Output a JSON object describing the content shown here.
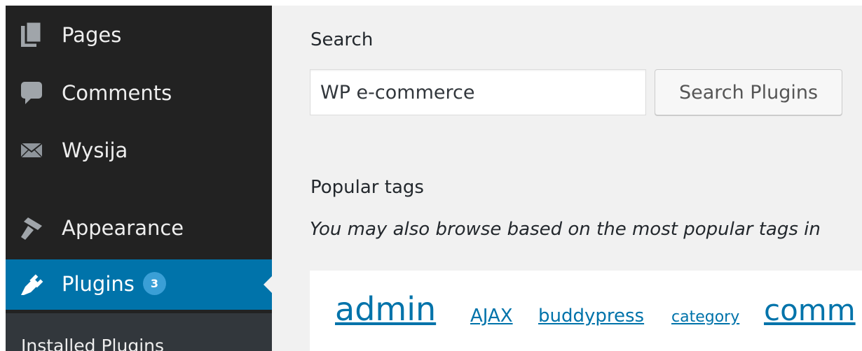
{
  "sidebar": {
    "items": [
      {
        "label": "Pages",
        "icon": "pages-icon"
      },
      {
        "label": "Comments",
        "icon": "comments-icon"
      },
      {
        "label": "Wysija",
        "icon": "envelope-icon"
      },
      {
        "label": "Appearance",
        "icon": "paintbrush-icon"
      },
      {
        "label": "Plugins",
        "icon": "plugin-icon",
        "badge": "3",
        "active": true
      }
    ],
    "submenu": [
      {
        "label": "Installed Plugins"
      }
    ]
  },
  "search": {
    "title": "Search",
    "input_value": "WP e-commerce",
    "button_label": "Search Plugins"
  },
  "popular_tags": {
    "title": "Popular tags",
    "description": "You may also browse based on the most popular tags in",
    "tags": [
      "admin",
      "AJAX",
      "buddypress",
      "category",
      "comm"
    ]
  },
  "colors": {
    "sidebar_bg": "#222222",
    "active_bg": "#0073aa",
    "badge_bg": "#3a9fd6",
    "link": "#0073aa",
    "page_bg": "#f1f1f1"
  }
}
